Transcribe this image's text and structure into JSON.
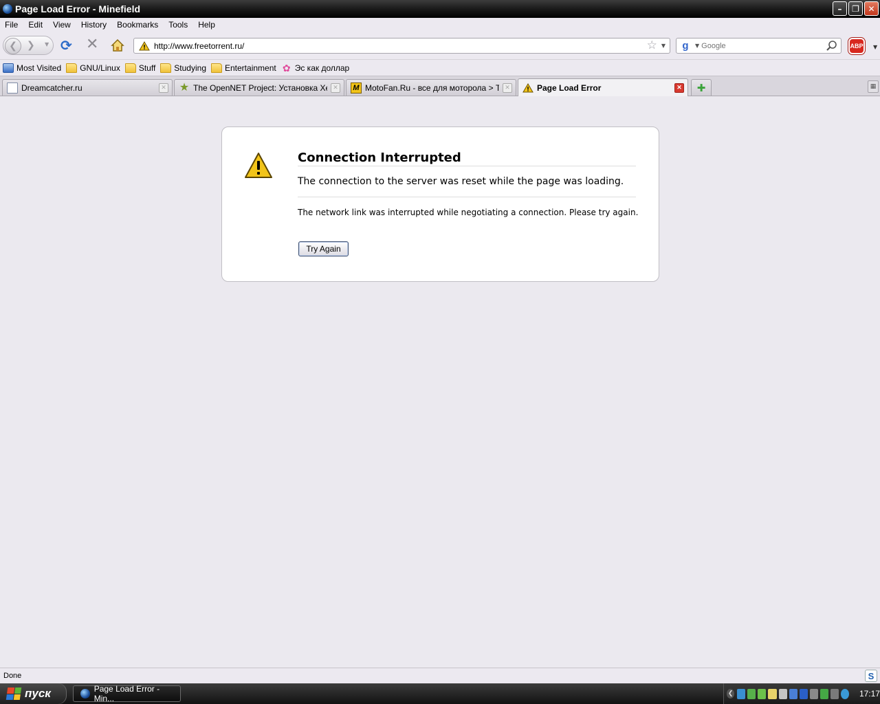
{
  "window": {
    "title": "Page Load Error - Minefield",
    "minimize_glyph": "–",
    "maximize_glyph": "❐",
    "close_glyph": "✕"
  },
  "menu": [
    "File",
    "Edit",
    "View",
    "History",
    "Bookmarks",
    "Tools",
    "Help"
  ],
  "navbar": {
    "url": "http://www.freetorrent.ru/",
    "search_placeholder": "Google",
    "abp_label": "ABP"
  },
  "bookmarks": [
    {
      "label": "Most Visited",
      "icon": "most-visited-icon"
    },
    {
      "label": "GNU/Linux",
      "icon": "folder-icon"
    },
    {
      "label": "Stuff",
      "icon": "folder-icon"
    },
    {
      "label": "Studying",
      "icon": "folder-icon"
    },
    {
      "label": "Entertainment",
      "icon": "folder-icon"
    },
    {
      "label": "Эс как доллар",
      "icon": "flower-icon"
    }
  ],
  "tabs": [
    {
      "label": "Dreamcatcher.ru",
      "icon": "page-icon",
      "active": false
    },
    {
      "label": "The OpenNET Project: Установка Xen ...",
      "icon": "star-icon",
      "active": false
    },
    {
      "label": "MotoFan.Ru - все для моторола > То...",
      "icon": "motofan-icon",
      "active": false
    },
    {
      "label": "Page Load Error",
      "icon": "warning-icon",
      "active": true
    }
  ],
  "error": {
    "title": "Connection Interrupted",
    "short_desc": "The connection to the server was reset while the page was loading.",
    "long_desc": "The network link was interrupted while negotiating a connection. Please try again.",
    "button_label": "Try Again"
  },
  "status": {
    "text": "Done",
    "s_label": "S"
  },
  "taskbar": {
    "start_label": "пуск",
    "task_label": "Page Load Error - Min...",
    "clock": "17:17"
  },
  "colors": {
    "accent_warning": "#f2c419",
    "close_red": "#d8382f",
    "content_bg": "#ebe9ef"
  }
}
